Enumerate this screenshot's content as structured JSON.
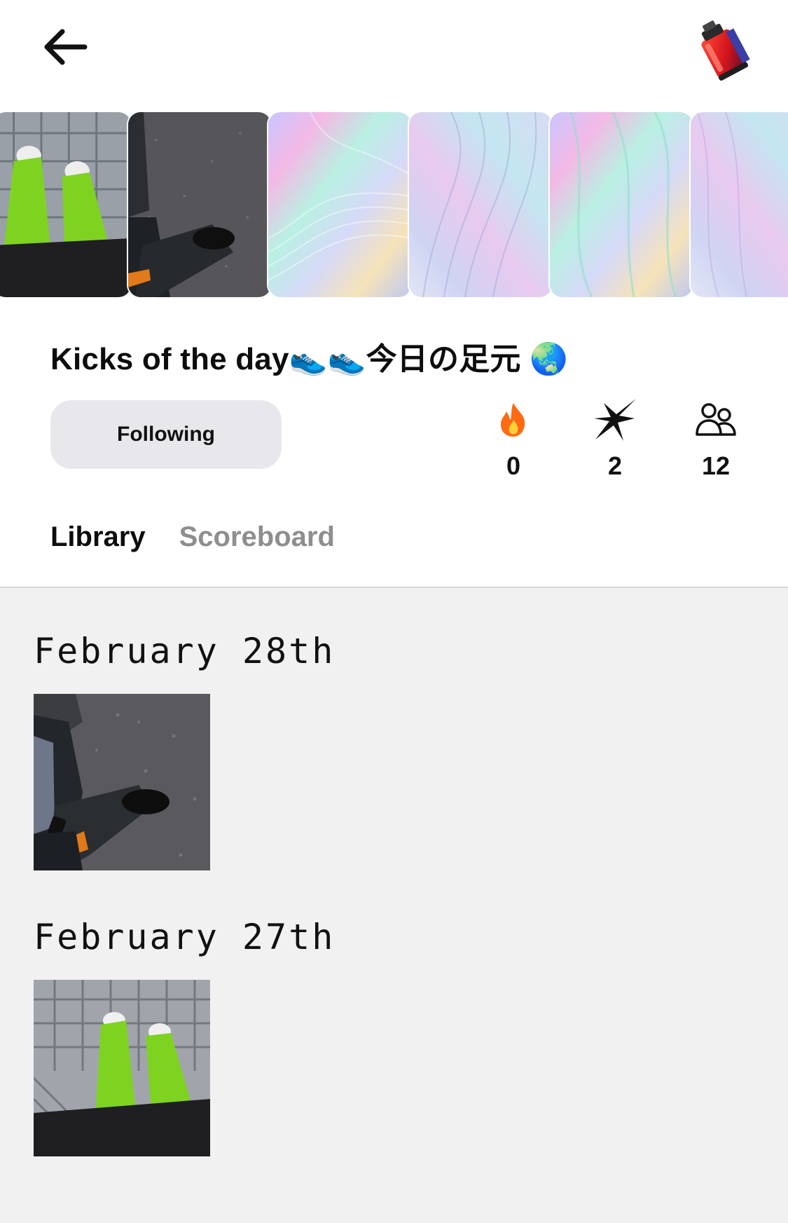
{
  "header": {
    "back_icon": "arrow-left-icon",
    "film_icon": "film-roll-icon"
  },
  "cover": {
    "tiles": [
      "photo-green-pants",
      "photo-black-shoes",
      "holographic",
      "holographic",
      "holographic",
      "holographic"
    ]
  },
  "club": {
    "title": "Kicks of the day👟👟今日の足元 🌏",
    "follow_label": "Following",
    "stats": [
      {
        "icon": "fire-icon",
        "value": "0"
      },
      {
        "icon": "sparkle-icon",
        "value": "2"
      },
      {
        "icon": "members-icon",
        "value": "12"
      }
    ]
  },
  "tabs": [
    {
      "label": "Library",
      "active": true
    },
    {
      "label": "Scoreboard",
      "active": false
    }
  ],
  "library": [
    {
      "date": "February 28th",
      "photo": "black-shoes-on-asphalt"
    },
    {
      "date": "February 27th",
      "photo": "green-pants-on-tiles"
    }
  ],
  "colors": {
    "background": "#f1f1f1",
    "card": "#ffffff",
    "button": "#e8e8ec",
    "inactive_tab": "#8e8e8e"
  }
}
